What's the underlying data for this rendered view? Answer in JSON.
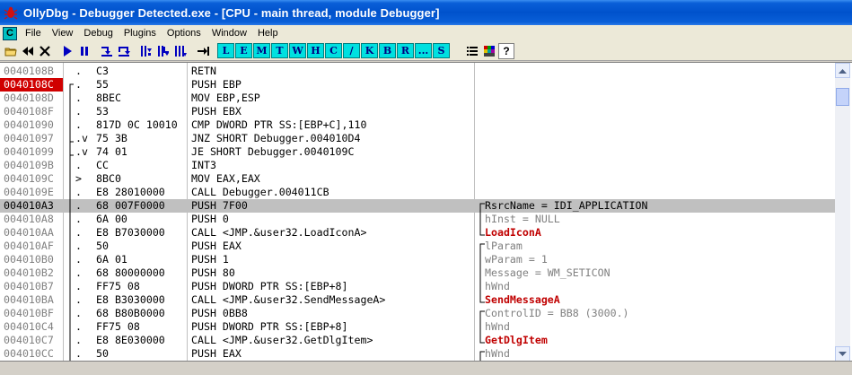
{
  "window": {
    "title": "OllyDbg - Debugger Detected.exe - [CPU - main thread, module Debugger]"
  },
  "menu": {
    "cpu_icon_label": "C",
    "items": [
      "File",
      "View",
      "Debug",
      "Plugins",
      "Options",
      "Window",
      "Help"
    ]
  },
  "toolbar": {
    "letters": [
      "L",
      "E",
      "M",
      "T",
      "W",
      "H",
      "C",
      "/",
      "K",
      "B",
      "R",
      "...",
      "S"
    ],
    "help_label": "?"
  },
  "disasm": [
    {
      "addr": "0040108B",
      "flag": ".",
      "hex": "C3",
      "dis": "RETN",
      "cmt": "",
      "cmt_style": ""
    },
    {
      "addr": "0040108C",
      "flag": ".",
      "hex": "55",
      "dis": "PUSH EBP",
      "cmt": "",
      "cmt_style": "",
      "eip": true
    },
    {
      "addr": "0040108D",
      "flag": ".",
      "hex": "8BEC",
      "dis": "MOV EBP,ESP",
      "cmt": "",
      "cmt_style": ""
    },
    {
      "addr": "0040108F",
      "flag": ".",
      "hex": "53",
      "dis": "PUSH EBX",
      "cmt": "",
      "cmt_style": ""
    },
    {
      "addr": "00401090",
      "flag": ".",
      "hex": "817D 0C 10010",
      "dis": "CMP DWORD PTR SS:[EBP+C],110",
      "cmt": "",
      "cmt_style": ""
    },
    {
      "addr": "00401097",
      "flag": ".v",
      "hex": "75 3B",
      "dis": "JNZ SHORT Debugger.004010D4",
      "cmt": "",
      "cmt_style": ""
    },
    {
      "addr": "00401099",
      "flag": ".v",
      "hex": "74 01",
      "dis": "JE SHORT Debugger.0040109C",
      "cmt": "",
      "cmt_style": ""
    },
    {
      "addr": "0040109B",
      "flag": ".",
      "hex": "CC",
      "dis": "INT3",
      "cmt": "",
      "cmt_style": ""
    },
    {
      "addr": "0040109C",
      "flag": ">",
      "hex": "8BC0",
      "dis": "MOV EAX,EAX",
      "cmt": "",
      "cmt_style": ""
    },
    {
      "addr": "0040109E",
      "flag": ".",
      "hex": "E8 28010000",
      "dis": "CALL Debugger.004011CB",
      "cmt": "",
      "cmt_style": ""
    },
    {
      "addr": "004010A3",
      "flag": ".",
      "hex": "68 007F0000",
      "dis": "PUSH 7F00",
      "cmt": "RsrcName = IDI_APPLICATION",
      "cmt_style": "",
      "sel": true
    },
    {
      "addr": "004010A8",
      "flag": ".",
      "hex": "6A 00",
      "dis": "PUSH 0",
      "cmt": "hInst = NULL",
      "cmt_style": "gray"
    },
    {
      "addr": "004010AA",
      "flag": ".",
      "hex": "E8 B7030000",
      "dis": "CALL <JMP.&user32.LoadIconA>",
      "cmt": "LoadIconA",
      "cmt_style": "red"
    },
    {
      "addr": "004010AF",
      "flag": ".",
      "hex": "50",
      "dis": "PUSH EAX",
      "cmt": "lParam",
      "cmt_style": "gray"
    },
    {
      "addr": "004010B0",
      "flag": ".",
      "hex": "6A 01",
      "dis": "PUSH 1",
      "cmt": "wParam = 1",
      "cmt_style": "gray"
    },
    {
      "addr": "004010B2",
      "flag": ".",
      "hex": "68 80000000",
      "dis": "PUSH 80",
      "cmt": "Message = WM_SETICON",
      "cmt_style": "gray"
    },
    {
      "addr": "004010B7",
      "flag": ".",
      "hex": "FF75 08",
      "dis": "PUSH DWORD PTR SS:[EBP+8]",
      "cmt": "hWnd",
      "cmt_style": "gray"
    },
    {
      "addr": "004010BA",
      "flag": ".",
      "hex": "E8 B3030000",
      "dis": "CALL <JMP.&user32.SendMessageA>",
      "cmt": "SendMessageA",
      "cmt_style": "red"
    },
    {
      "addr": "004010BF",
      "flag": ".",
      "hex": "68 B80B0000",
      "dis": "PUSH 0BB8",
      "cmt": "ControlID = BB8 (3000.)",
      "cmt_style": "gray"
    },
    {
      "addr": "004010C4",
      "flag": ".",
      "hex": "FF75 08",
      "dis": "PUSH DWORD PTR SS:[EBP+8]",
      "cmt": "hWnd",
      "cmt_style": "gray"
    },
    {
      "addr": "004010C7",
      "flag": ".",
      "hex": "E8 8E030000",
      "dis": "CALL <JMP.&user32.GetDlgItem>",
      "cmt": "GetDlgItem",
      "cmt_style": "red"
    },
    {
      "addr": "004010CC",
      "flag": ".",
      "hex": "50",
      "dis": "PUSH EAX",
      "cmt": "hWnd",
      "cmt_style": "gray"
    }
  ]
}
